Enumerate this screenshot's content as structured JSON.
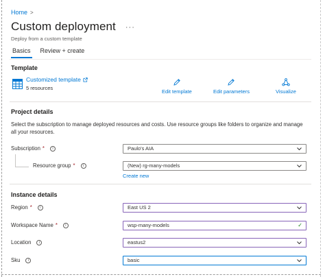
{
  "breadcrumb": {
    "home": "Home",
    "separator": ">"
  },
  "header": {
    "title": "Custom deployment",
    "more": "···",
    "subtitle": "Deploy from a custom template"
  },
  "tabs": [
    {
      "label": "Basics",
      "active": true
    },
    {
      "label": "Review + create",
      "active": false
    }
  ],
  "template": {
    "section_title": "Template",
    "name": "Customized template",
    "resources": "5 resources",
    "actions": {
      "edit_template": "Edit template",
      "edit_parameters": "Edit parameters",
      "visualize": "Visualize"
    }
  },
  "project": {
    "section_title": "Project details",
    "description": "Select the subscription to manage deployed resources and costs. Use resource groups like folders to organize and manage all your resources.",
    "subscription": {
      "label": "Subscription",
      "required": "*",
      "value": "Paulo's AIA"
    },
    "resource_group": {
      "label": "Resource group",
      "required": "*",
      "value": "(New) rg-many-models",
      "create_new": "Create new"
    }
  },
  "instance": {
    "section_title": "Instance details",
    "region": {
      "label": "Region",
      "required": "*",
      "value": "East US 2"
    },
    "workspace": {
      "label": "Workspace Name",
      "required": "*",
      "value": "wsp-many-models"
    },
    "location": {
      "label": "Location",
      "value": "eastus2"
    },
    "sku": {
      "label": "Sku",
      "value": "basic"
    }
  },
  "icons": {
    "info": "i",
    "check": "✓"
  },
  "colors": {
    "accent": "#0078d4",
    "required": "#a4262c",
    "valid": "#107c10",
    "focus": "#8764b8"
  }
}
